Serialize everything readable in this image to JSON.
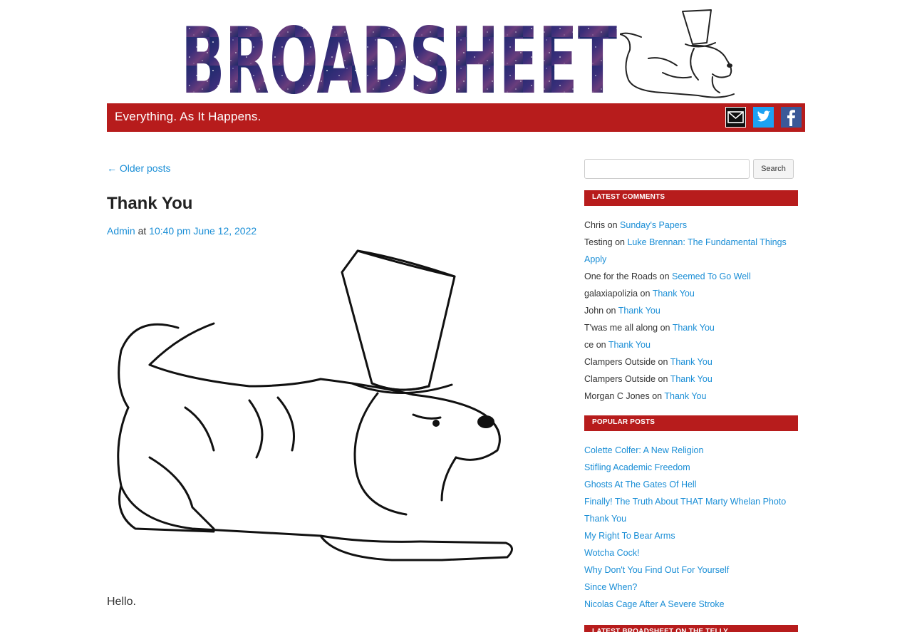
{
  "site": {
    "logo_text": "BROADSHEET",
    "tagline": "Everything. As It Happens.",
    "social": [
      "mail-icon",
      "twitter-icon",
      "facebook-icon"
    ],
    "brand_color": "#b71c1c"
  },
  "nav": {
    "older_posts": "← Older posts"
  },
  "post": {
    "title": "Thank You",
    "author": "Admin",
    "at": "at",
    "time": "10:40 pm",
    "date": "June 12, 2022",
    "body": "Hello."
  },
  "sidebar": {
    "search_button": "Search",
    "latest_comments_title": "LATEST COMMENTS",
    "comments": [
      {
        "who": "Chris",
        "on": "on",
        "post": "Sunday's Papers"
      },
      {
        "who": "Testing",
        "on": "on",
        "post": "Luke Brennan: The Fundamental Things Apply"
      },
      {
        "who": "One for the Roads",
        "on": "on",
        "post": "Seemed To Go Well"
      },
      {
        "who": "galaxiapolizia",
        "on": "on",
        "post": "Thank You"
      },
      {
        "who": "John",
        "on": "on",
        "post": "Thank You"
      },
      {
        "who": "T'was me all along",
        "on": "on",
        "post": "Thank You"
      },
      {
        "who": "ce",
        "on": "on",
        "post": "Thank You"
      },
      {
        "who": "Clampers Outside",
        "on": "on",
        "post": "Thank You"
      },
      {
        "who": "Clampers Outside",
        "on": "on",
        "post": "Thank You"
      },
      {
        "who": "Morgan C Jones",
        "on": "on",
        "post": "Thank You"
      }
    ],
    "popular_title": "POPULAR POSTS",
    "popular": [
      "Colette Colfer: A New Religion",
      "Stifling Academic Freedom",
      "Ghosts At The Gates Of Hell",
      "Finally! The Truth About THAT Marty Whelan Photo",
      "Thank You",
      "My Right To Bear Arms",
      "Wotcha Cock!",
      "Why Don't You Find Out For Yourself",
      "Since When?",
      "Nicolas Cage After A Severe Stroke"
    ],
    "telly_title": "LATEST BROADSHEET ON THE TELLY"
  }
}
